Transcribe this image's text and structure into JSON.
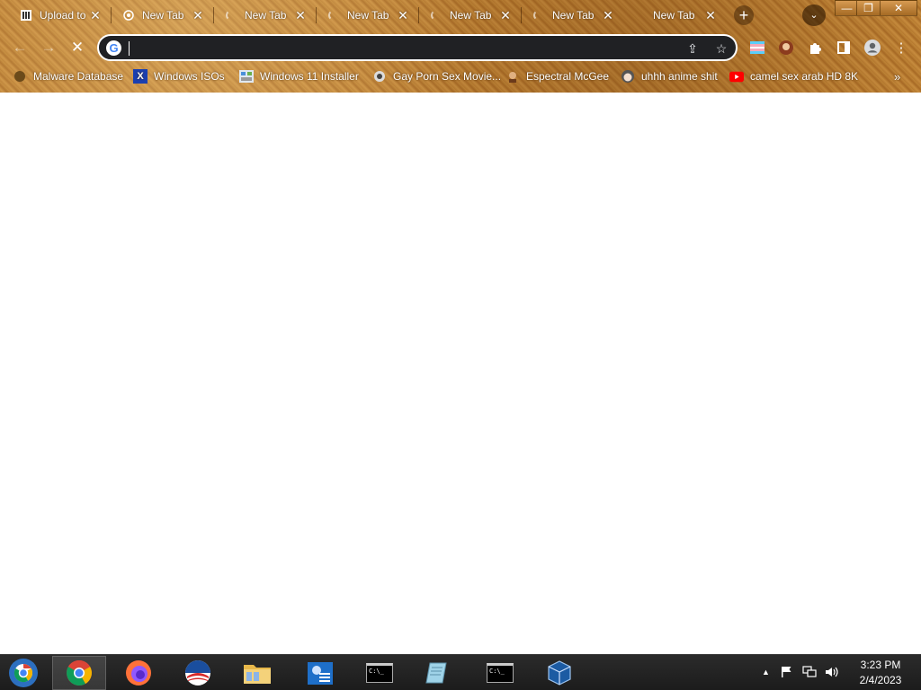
{
  "tabs": [
    {
      "title": "Upload to",
      "favicon": "archive-icon",
      "active": false
    },
    {
      "title": "New Tab",
      "favicon": "chrome-icon",
      "active": false
    },
    {
      "title": "New Tab",
      "favicon": "loading-spinner-icon",
      "active": false
    },
    {
      "title": "New Tab",
      "favicon": "loading-spinner-icon",
      "active": false
    },
    {
      "title": "New Tab",
      "favicon": "loading-spinner-icon",
      "active": false
    },
    {
      "title": "New Tab",
      "favicon": "loading-spinner-icon",
      "active": false
    },
    {
      "title": "New Tab",
      "favicon": "loading-spinner-icon",
      "active": true
    }
  ],
  "tab_close_glyph": "✕",
  "newtab_glyph": "+",
  "tab_search_glyph": "⌄",
  "window_controls": {
    "minimize": "—",
    "restore": "❐",
    "close": "✕"
  },
  "toolbar": {
    "back": "←",
    "forward": "→",
    "stop": "✕"
  },
  "omnibox": {
    "value": "",
    "placeholder": "",
    "search_engine_letter": "G"
  },
  "omnibox_icons": {
    "share": "⇪",
    "bookmark_star": "☆"
  },
  "toolbar_icons": {
    "extension1": "pride-flag-icon",
    "extension2": "avatar-icon",
    "extensions": "puzzle-icon",
    "side_panel": "side-panel-icon",
    "profile": "profile-icon",
    "menu": "⋮"
  },
  "bookmarks": [
    {
      "label": "Malware Database",
      "icon": "malware-icon"
    },
    {
      "label": "Windows ISOs",
      "icon": "x-icon"
    },
    {
      "label": "Windows 11 Installer",
      "icon": "image-icon"
    },
    {
      "label": "Gay Porn Sex Movie...",
      "icon": "bookmark-favicon-icon"
    },
    {
      "label": "Espectral McGee",
      "icon": "character-icon"
    },
    {
      "label": "uhhh anime shit",
      "icon": "anime-icon"
    },
    {
      "label": "camel sex arab HD 8K",
      "icon": "youtube-icon"
    }
  ],
  "bookmarks_overflow": "»",
  "taskbar": {
    "apps": [
      {
        "name": "start-orb",
        "active": false
      },
      {
        "name": "chrome",
        "active": true
      },
      {
        "name": "firefox",
        "active": false
      },
      {
        "name": "obama-logo",
        "active": false
      },
      {
        "name": "file-explorer",
        "active": false
      },
      {
        "name": "control-panel",
        "active": false
      },
      {
        "name": "command-prompt",
        "active": false
      },
      {
        "name": "notepad",
        "active": false
      },
      {
        "name": "command-prompt-2",
        "active": false
      },
      {
        "name": "virtualbox",
        "active": false
      }
    ],
    "cmd_label": "C:\\_",
    "tray_show_hidden": "▲",
    "time": "3:23 PM",
    "date": "2/4/2023"
  },
  "colors": {
    "omnibox_bg": "#202124",
    "taskbar_bg": "#1c1c1c",
    "theme_base": "#b77c34"
  }
}
